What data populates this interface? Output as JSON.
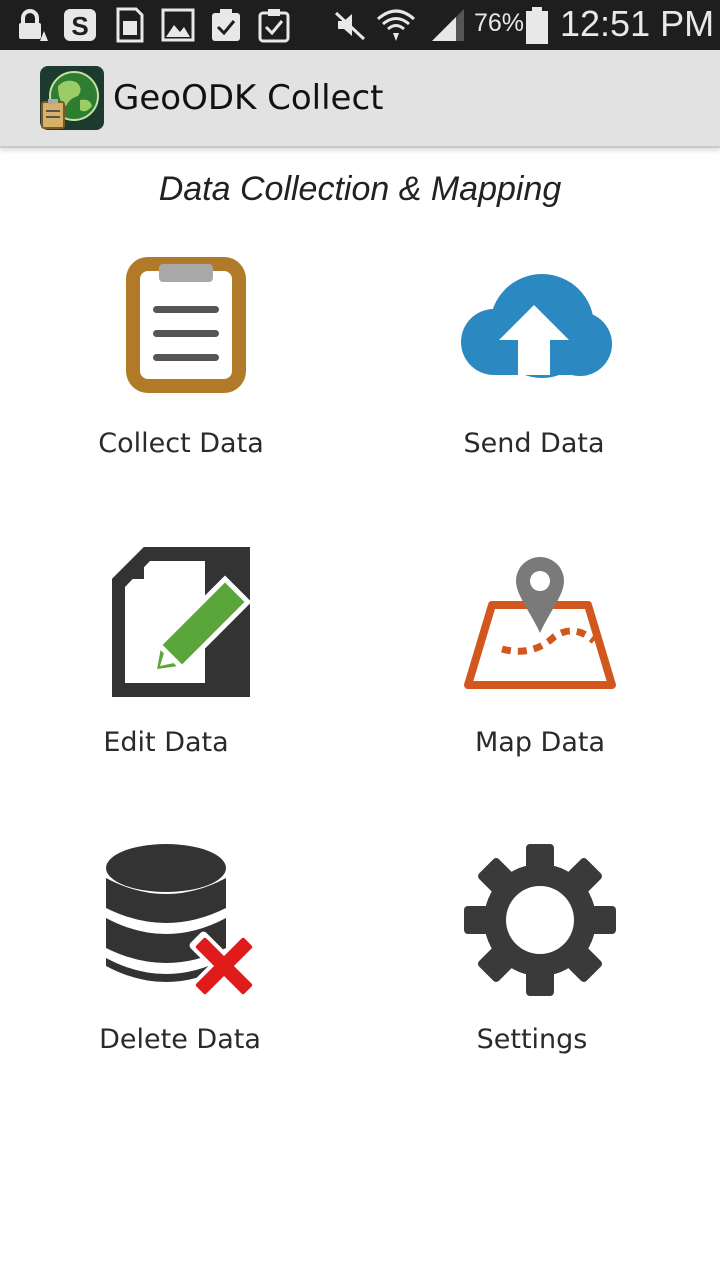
{
  "status_bar": {
    "battery_pct": "76%",
    "time": "12:51 PM",
    "icons": [
      "lock-icon",
      "s-icon",
      "sim-icon",
      "image-icon",
      "clipboard-check-icon",
      "clipboard-check-icon",
      "mute-icon",
      "wifi-icon",
      "signal-icon",
      "battery-icon"
    ]
  },
  "action_bar": {
    "title": "GeoODK Collect",
    "icon": "geoodk-logo-icon"
  },
  "main": {
    "subtitle": "Data Collection & Mapping",
    "tiles": [
      {
        "label": "Collect Data",
        "icon": "clipboard-icon",
        "color": "#b07a28"
      },
      {
        "label": "Send Data",
        "icon": "cloud-upload-icon",
        "color": "#2b88c0"
      },
      {
        "label": "Edit Data",
        "icon": "edit-document-icon",
        "color": "#5aa63a"
      },
      {
        "label": "Map Data",
        "icon": "map-pin-icon",
        "color": "#d2571e"
      },
      {
        "label": "Delete Data",
        "icon": "database-delete-icon",
        "color": "#e01b1b"
      },
      {
        "label": "Settings",
        "icon": "gear-icon",
        "color": "#3a3a3a"
      }
    ]
  }
}
